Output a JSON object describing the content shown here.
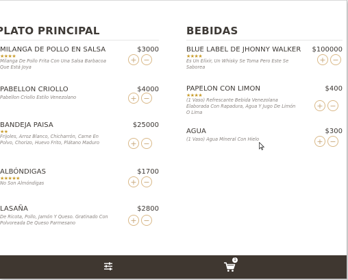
{
  "menu": {
    "main_title": "PLATO PRINCIPAL",
    "drinks_title": "BEBIDAS",
    "main_items": [
      {
        "name": "MILANGA DE POLLO EN SALSA",
        "price": "$3000",
        "stars": "★★★★",
        "desc": "Milanga De Pollo Frita Con Una Salsa Barbacoa Que Está Joya"
      },
      {
        "name": "PABELLON CRIOLLO",
        "price": "$4000",
        "stars": "",
        "desc": "Pabellon Criollo Estilo Venezolano"
      },
      {
        "name": "BANDEJA PAISA",
        "price": "$25000",
        "stars": "★★",
        "desc": "Frijoles, Arroz Blanco, Chicharrón, Carne En Polvo, Chorizo, Huevo Frito, Plátano Maduro"
      },
      {
        "name": "ALBÓNDIGAS",
        "price": "$1700",
        "stars": "★★★★★",
        "desc": "No Son Almóndigas"
      },
      {
        "name": "LASAÑA",
        "price": "$2800",
        "stars": "",
        "desc": "De Ricota, Pollo, Jamón Y Queso. Gratinado Con Polvoreada De Queso Parmesano"
      }
    ],
    "drink_items": [
      {
        "name": "BLUE LABEL DE JHONNY WALKER",
        "price": "$100000",
        "stars": "★★★★",
        "desc": "Es Un Elíxir, Un Whisky Se Toma Pero Este Se Saborea"
      },
      {
        "name": "PAPELON CON LIMON",
        "price": "$400",
        "stars": "★★★★",
        "desc": "(1 Vaso) Refrescante Bebida Venezolana Elaborada Con Rapadura, Agua Y Jugo De Limón O Lima"
      },
      {
        "name": "AGUA",
        "price": "$300",
        "stars": "",
        "desc": "(1 Vaso) Agua Mineral Con Hielo"
      }
    ],
    "add_label": "+",
    "remove_label": "−"
  },
  "cart": {
    "badge": "1"
  },
  "icons": {
    "filter": "sliders-icon",
    "cart": "cart-icon"
  },
  "colors": {
    "bottom_bar": "#3f3730",
    "accent": "#c89c2d",
    "button_border": "#d9b887"
  }
}
